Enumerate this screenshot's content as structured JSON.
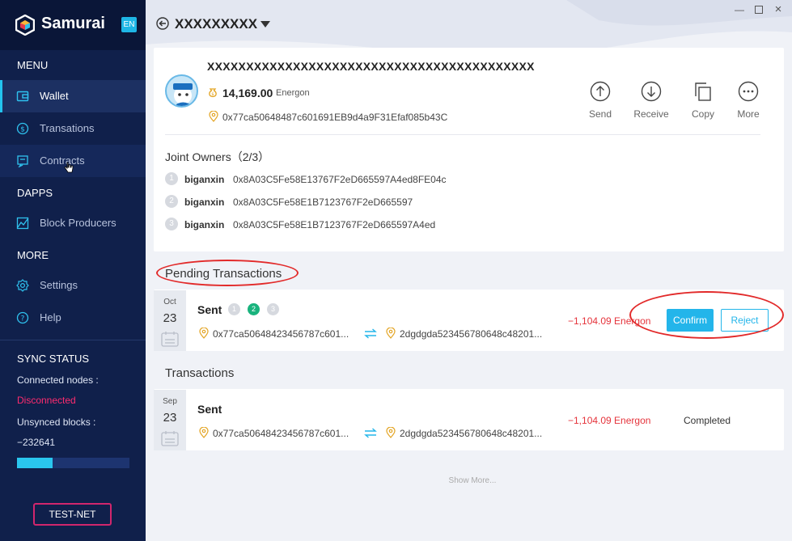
{
  "app": {
    "brand": "Samurai",
    "lang": "EN"
  },
  "sidebar": {
    "menu_title": "MENU",
    "items": [
      {
        "label": "Wallet",
        "icon": "wallet-icon"
      },
      {
        "label": "Transations",
        "icon": "dollar-icon"
      },
      {
        "label": "Contracts",
        "icon": "contract-icon"
      }
    ],
    "dapps_title": "DAPPS",
    "dapps": [
      {
        "label": "Block Producers",
        "icon": "producers-icon"
      }
    ],
    "more_title": "MORE",
    "more": [
      {
        "label": "Settings",
        "icon": "gear-icon"
      },
      {
        "label": "Help",
        "icon": "help-icon"
      }
    ],
    "sync": {
      "title": "SYNC STATUS",
      "nodes_label": "Connected nodes :",
      "nodes_value": "Disconnected",
      "blocks_label": "Unsynced blocks :",
      "blocks_value": "−232641",
      "progress": 0.32
    },
    "network_button": "TEST-NET"
  },
  "header": {
    "account_name": "XXXXXXXXX"
  },
  "wallet": {
    "name": "XXXXXXXXXXXXXXXXXXXXXXXXXXXXXXXXXXXXXXXXXX",
    "balance": "14,169.00",
    "unit": "Energon",
    "address": "0x77ca50648487c601691EB9d4a9F31Efaf085b43C",
    "actions": [
      {
        "label": "Send",
        "icon": "send-icon"
      },
      {
        "label": "Receive",
        "icon": "receive-icon"
      },
      {
        "label": "Copy",
        "icon": "copy-icon"
      },
      {
        "label": "More",
        "icon": "more-icon"
      }
    ],
    "joint_owners_title": "Joint Owners（2/3）",
    "owners": [
      {
        "num": "1",
        "name": "biganxin",
        "address": "0x8A03C5Fe58E13767F2eD665597A4ed8FE04c"
      },
      {
        "num": "2",
        "name": "biganxin",
        "address": "0x8A03C5Fe58E1B7123767F2eD665597"
      },
      {
        "num": "3",
        "name": "biganxin",
        "address": "0x8A03C5Fe58E1B7123767F2eD665597A4ed"
      }
    ]
  },
  "pending": {
    "title": "Pending Transactions",
    "items": [
      {
        "month": "Oct",
        "day": "23",
        "type": "Sent",
        "steps": [
          "1",
          "2",
          "3"
        ],
        "from": "0x77ca50648423456787c601...",
        "to": "2dgdgda523456780648c48201...",
        "amount": "−1,104.09 Energon",
        "confirm": "Confirm",
        "reject": "Reject"
      }
    ]
  },
  "transactions": {
    "title": "Transactions",
    "items": [
      {
        "month": "Sep",
        "day": "23",
        "type": "Sent",
        "from": "0x77ca50648423456787c601...",
        "to": "2dgdgda523456780648c48201...",
        "amount": "−1,104.09 Energon",
        "status": "Completed"
      }
    ],
    "show_more": "Show More..."
  },
  "colors": {
    "sidebar": "#10204b",
    "accent": "#23b5ea",
    "negative": "#e5333b",
    "danger": "#ff2b6f"
  }
}
